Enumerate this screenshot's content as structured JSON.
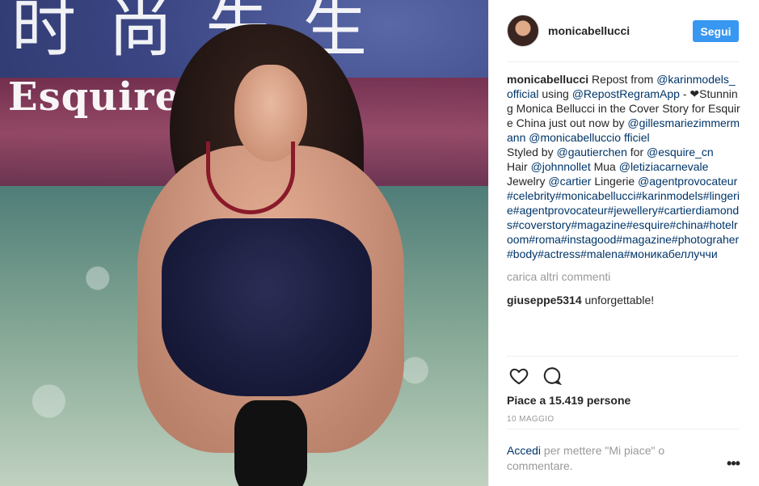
{
  "photo": {
    "magazine_chinese": "时尚先生",
    "magazine_title": "Esquire"
  },
  "header": {
    "username": "monicabellucci",
    "follow_label": "Segui"
  },
  "caption": {
    "username": "monicabellucci",
    "segments": [
      {
        "text": " Repost from ",
        "link": false
      },
      {
        "text": "@karinmodels_official",
        "link": true
      },
      {
        "text": " using ",
        "link": false
      },
      {
        "text": "@RepostRegramApp",
        "link": true
      },
      {
        "text": " - ❤Stunning Monica Bellucci in the Cover Story for Esquire China just out now by ",
        "link": false
      },
      {
        "text": "@gillesmariezimmermann",
        "link": true
      },
      {
        "text": " ",
        "link": false
      },
      {
        "text": "@monicabelluccio fficiel",
        "link": true
      },
      {
        "text": "\nStyled by ",
        "link": false
      },
      {
        "text": "@gautierchen",
        "link": true
      },
      {
        "text": " for ",
        "link": false
      },
      {
        "text": "@esquire_cn",
        "link": true
      },
      {
        "text": "\nHair ",
        "link": false
      },
      {
        "text": "@johnnollet",
        "link": true
      },
      {
        "text": " Mua ",
        "link": false
      },
      {
        "text": "@letiziacarnevale",
        "link": true
      },
      {
        "text": "\nJewelry ",
        "link": false
      },
      {
        "text": "@cartier",
        "link": true
      },
      {
        "text": " Lingerie ",
        "link": false
      },
      {
        "text": "@agentprovocateur",
        "link": true
      },
      {
        "text": " ",
        "link": false
      },
      {
        "text": "#celebrity#monicabellucci#karinmodels#lingerie#agentprovocateur#jewellery#cartierdiamonds#coverstory#magazine#esquire#china#hotelroom#roma#instagood#magazine#photograher#body#actress#malena#моникабеллуччи",
        "link": true
      }
    ]
  },
  "load_more": "carica altri commenti",
  "comments": [
    {
      "username": "giuseppe5314",
      "text": " unforgettable!"
    }
  ],
  "likes": "Piace a 15.419 persone",
  "date": "10 MAGGIO",
  "login": {
    "link": "Accedi",
    "text": " per mettere \"Mi piace\" o commentare."
  },
  "more_label": "•••",
  "icons": {
    "like": "heart-outline-icon",
    "comment": "speech-bubble-icon"
  },
  "colors": {
    "accent": "#3897f0",
    "link": "#003569",
    "muted": "#999999",
    "text": "#262626"
  }
}
